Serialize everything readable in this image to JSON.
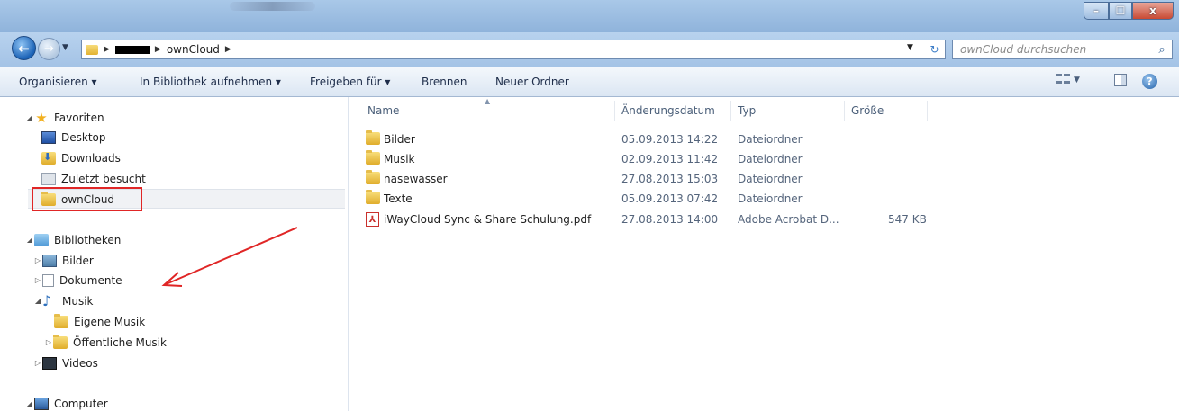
{
  "titlebar": {
    "buttons": {
      "minimize": "–",
      "maximize": "☐",
      "close": "x"
    }
  },
  "address": {
    "crumbs": [
      "ownCloud"
    ],
    "search_placeholder": "ownCloud durchsuchen"
  },
  "toolbar": {
    "organize": "Organisieren ▾",
    "add_to_library": "In Bibliothek aufnehmen ▾",
    "share_with": "Freigeben für ▾",
    "burn": "Brennen",
    "new_folder": "Neuer Ordner"
  },
  "nav": {
    "favorites": {
      "label": "Favoriten",
      "items": [
        "Desktop",
        "Downloads",
        "Zuletzt besucht",
        "ownCloud"
      ]
    },
    "libraries": {
      "label": "Bibliotheken",
      "items": [
        "Bilder",
        "Dokumente",
        "Musik",
        "Eigene Musik",
        "Öffentliche Musik",
        "Videos"
      ]
    },
    "computer": "Computer",
    "selected": "ownCloud"
  },
  "columns": {
    "name": "Name",
    "date": "Änderungsdatum",
    "type": "Typ",
    "size": "Größe"
  },
  "files": [
    {
      "name": "Bilder",
      "date": "05.09.2013 14:22",
      "type": "Dateiordner",
      "size": "",
      "kind": "folder"
    },
    {
      "name": "Musik",
      "date": "02.09.2013 11:42",
      "type": "Dateiordner",
      "size": "",
      "kind": "folder"
    },
    {
      "name": "nasewasser",
      "date": "27.08.2013 15:03",
      "type": "Dateiordner",
      "size": "",
      "kind": "folder"
    },
    {
      "name": "Texte",
      "date": "05.09.2013 07:42",
      "type": "Dateiordner",
      "size": "",
      "kind": "folder"
    },
    {
      "name": "iWayCloud Sync & Share Schulung.pdf",
      "date": "27.08.2013 14:00",
      "type": "Adobe Acrobat D...",
      "size": "547 KB",
      "kind": "pdf"
    }
  ],
  "annotation": {
    "color": "#e02626"
  }
}
